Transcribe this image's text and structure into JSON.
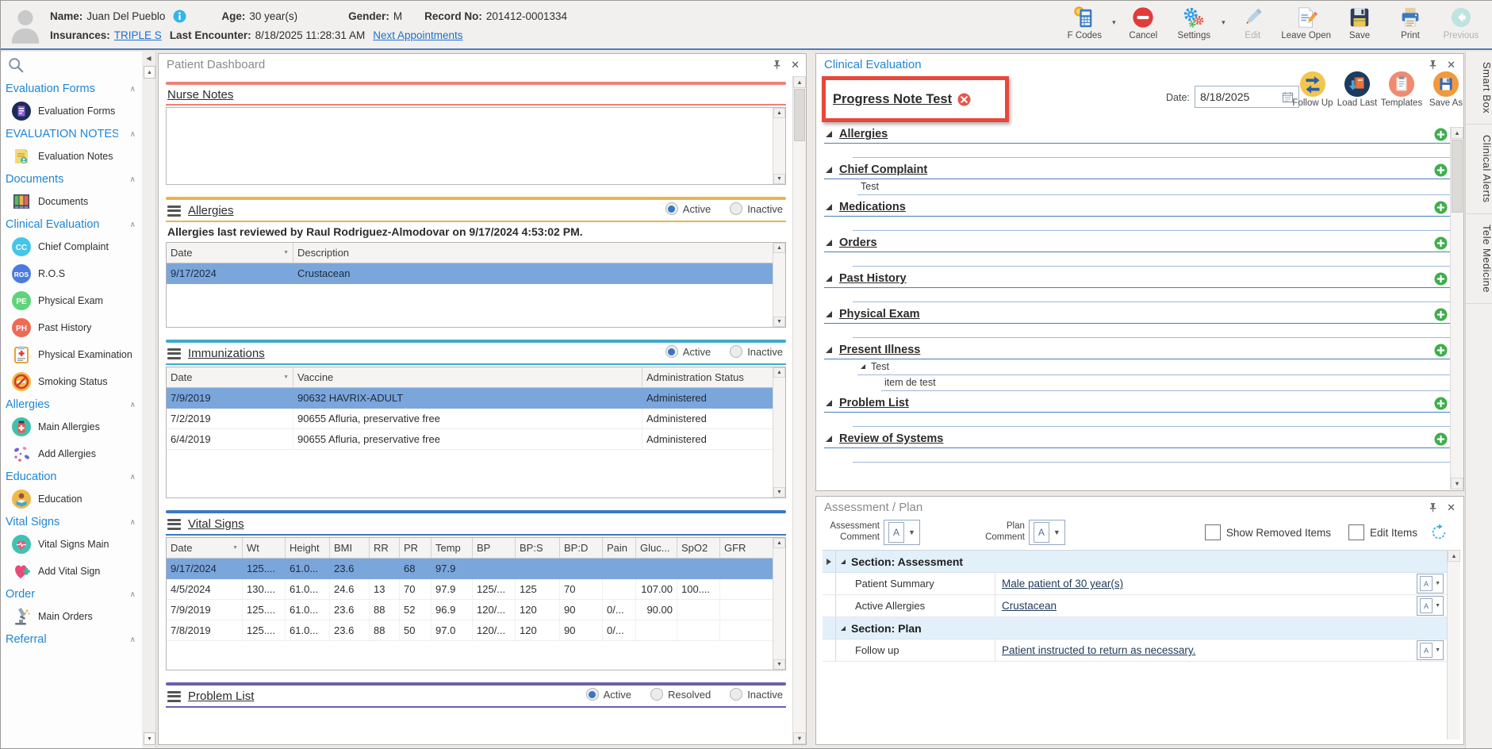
{
  "header": {
    "fields": {
      "name_label": "Name:",
      "name_value": "Juan Del Pueblo",
      "age_label": "Age:",
      "age_value": "30 year(s)",
      "gender_label": "Gender:",
      "gender_value": "M",
      "record_label": "Record No:",
      "record_value": "201412-0001334",
      "insurances_label": "Insurances:",
      "insurances_value": "TRIPLE S",
      "last_encounter_label": "Last Encounter:",
      "last_encounter_value": "8/18/2025 11:28:31 AM",
      "next_appointments_label": "Next Appointments"
    },
    "toolbar": [
      {
        "label": "F Codes",
        "icon": "fcodes-icon",
        "dropdown": true,
        "disabled": false
      },
      {
        "label": "Cancel",
        "icon": "cancel-icon",
        "dropdown": false,
        "disabled": false
      },
      {
        "label": "Settings",
        "icon": "settings-icon",
        "dropdown": true,
        "disabled": false
      },
      {
        "label": "Edit",
        "icon": "edit-icon",
        "dropdown": false,
        "disabled": true
      },
      {
        "label": "Leave Open",
        "icon": "leave-open-icon",
        "dropdown": false,
        "disabled": false
      },
      {
        "label": "Save",
        "icon": "save-icon",
        "dropdown": false,
        "disabled": false
      },
      {
        "label": "Print",
        "icon": "print-icon",
        "dropdown": false,
        "disabled": false
      },
      {
        "label": "Previous",
        "icon": "previous-icon",
        "dropdown": false,
        "disabled": true
      }
    ]
  },
  "sidebar": {
    "sections": [
      {
        "label": "Evaluation Forms",
        "items": [
          {
            "label": "Evaluation Forms",
            "icon": "evaluation-forms-icon"
          }
        ]
      },
      {
        "label": "EVALUATION NOTES",
        "items": [
          {
            "label": "Evaluation Notes",
            "icon": "evaluation-notes-icon"
          }
        ]
      },
      {
        "label": "Documents",
        "items": [
          {
            "label": "Documents",
            "icon": "documents-icon"
          }
        ]
      },
      {
        "label": "Clinical Evaluation",
        "items": [
          {
            "label": "Chief Complaint",
            "icon": "chief-complaint-icon"
          },
          {
            "label": "R.O.S",
            "icon": "ros-icon"
          },
          {
            "label": "Physical Exam",
            "icon": "physical-exam-icon"
          },
          {
            "label": "Past History",
            "icon": "past-history-icon"
          },
          {
            "label": "Physical Examination",
            "icon": "physical-examination-icon"
          },
          {
            "label": "Smoking Status",
            "icon": "smoking-status-icon"
          }
        ]
      },
      {
        "label": "Allergies",
        "items": [
          {
            "label": "Main Allergies",
            "icon": "main-allergies-icon"
          },
          {
            "label": "Add Allergies",
            "icon": "add-allergies-icon"
          }
        ]
      },
      {
        "label": "Education",
        "items": [
          {
            "label": "Education",
            "icon": "education-icon"
          }
        ]
      },
      {
        "label": "Vital Signs",
        "items": [
          {
            "label": "Vital Signs Main",
            "icon": "vital-signs-main-icon"
          },
          {
            "label": "Add Vital Sign",
            "icon": "add-vital-sign-icon"
          }
        ]
      },
      {
        "label": "Order",
        "items": [
          {
            "label": "Main Orders",
            "icon": "main-orders-icon"
          }
        ]
      },
      {
        "label": "Referral",
        "items": []
      }
    ]
  },
  "dashboard": {
    "title": "Patient Dashboard",
    "nurse_notes": {
      "title": "Nurse Notes",
      "text": "",
      "accent": "#ef8077"
    },
    "allergies": {
      "title": "Allergies",
      "accent": "#e6b54f",
      "filters": [
        {
          "label": "Active",
          "selected": true
        },
        {
          "label": "Inactive",
          "selected": false
        }
      ],
      "review_note": "Allergies last reviewed by Raul Rodriguez-Almodovar on 9/17/2024 4:53:02 PM.",
      "columns": [
        "Date",
        "Description"
      ],
      "rows": [
        {
          "cells": [
            "9/17/2024",
            "Crustacean"
          ],
          "selected": true
        }
      ]
    },
    "immunizations": {
      "title": "Immunizations",
      "accent": "#3fa9c9",
      "filters": [
        {
          "label": "Active",
          "selected": true
        },
        {
          "label": "Inactive",
          "selected": false
        }
      ],
      "columns": [
        "Date",
        "Vaccine",
        "Administration Status"
      ],
      "rows": [
        {
          "cells": [
            "7/9/2019",
            "90632 HAVRIX-ADULT",
            "Administered"
          ],
          "selected": true
        },
        {
          "cells": [
            "7/2/2019",
            "90655 Afluria, preservative free",
            "Administered"
          ],
          "selected": false
        },
        {
          "cells": [
            "6/4/2019",
            "90655 Afluria, preservative free",
            "Administered"
          ],
          "selected": false
        }
      ]
    },
    "vital_signs": {
      "title": "Vital Signs",
      "accent": "#3d78c0",
      "columns": [
        "Date",
        "Wt",
        "Height",
        "BMI",
        "RR",
        "PR",
        "Temp",
        "BP",
        "BP:S",
        "BP:D",
        "Pain",
        "Gluc...",
        "SpO2",
        "GFR"
      ],
      "rows": [
        {
          "cells": [
            "9/17/2024",
            "125....",
            "61.0...",
            "23.6",
            "",
            "68",
            "97.9",
            "",
            "",
            "",
            "",
            "",
            "",
            ""
          ],
          "selected": true
        },
        {
          "cells": [
            "4/5/2024",
            "130....",
            "61.0...",
            "24.6",
            "13",
            "70",
            "97.9",
            "125/...",
            "125",
            "70",
            "",
            "107.00",
            "100....",
            ""
          ],
          "selected": false
        },
        {
          "cells": [
            "7/9/2019",
            "125....",
            "61.0...",
            "23.6",
            "88",
            "52",
            "96.9",
            "120/...",
            "120",
            "90",
            "0/...",
            "90.00",
            "",
            ""
          ],
          "selected": false
        },
        {
          "cells": [
            "7/8/2019",
            "125....",
            "61.0...",
            "23.6",
            "88",
            "50",
            "97.0",
            "120/...",
            "120",
            "90",
            "0/...",
            "",
            "",
            ""
          ],
          "selected": false
        }
      ]
    },
    "problem_list": {
      "title": "Problem List",
      "accent": "#6b61ae",
      "filters": [
        {
          "label": "Active",
          "selected": true
        },
        {
          "label": "Resolved",
          "selected": false
        },
        {
          "label": "Inactive",
          "selected": false
        }
      ]
    }
  },
  "clinical_evaluation": {
    "panel_title": "Clinical Evaluation",
    "note_title": "Progress Note Test",
    "date_label": "Date:",
    "date_value": "8/18/2025",
    "actions": [
      {
        "label": "Follow Up",
        "icon": "follow-up-icon"
      },
      {
        "label": "Load Last",
        "icon": "load-last-icon"
      },
      {
        "label": "Templates",
        "icon": "templates-icon"
      },
      {
        "label": "Save As",
        "icon": "save-as-icon"
      }
    ],
    "sections": [
      {
        "label": "Allergies",
        "items": []
      },
      {
        "label": "Chief Complaint",
        "items": [
          {
            "text": "Test",
            "level": 1,
            "expander": false
          }
        ]
      },
      {
        "label": "Medications",
        "items": []
      },
      {
        "label": "Orders",
        "items": []
      },
      {
        "label": "Past History",
        "items": []
      },
      {
        "label": "Physical Exam",
        "items": []
      },
      {
        "label": "Present Illness",
        "items": [
          {
            "text": "Test",
            "level": 1,
            "expander": true
          },
          {
            "text": "item de test",
            "level": 2,
            "expander": false
          }
        ]
      },
      {
        "label": "Problem List",
        "items": []
      },
      {
        "label": "Review of Systems",
        "items": []
      }
    ]
  },
  "assessment_plan": {
    "title": "Assessment / Plan",
    "assessment_comment_label": "Assessment Comment",
    "plan_comment_label": "Plan Comment",
    "show_removed_label": "Show Removed Items",
    "edit_items_label": "Edit Items",
    "groups": [
      {
        "header": "Section: Assessment",
        "rows": [
          {
            "label": "Patient Summary",
            "value": "Male patient of 30 year(s)"
          },
          {
            "label": "Active Allergies",
            "value": "Crustacean"
          }
        ]
      },
      {
        "header": "Section: Plan",
        "rows": [
          {
            "label": "Follow up",
            "value": "Patient instructed to return as necessary."
          }
        ]
      }
    ]
  },
  "right_tabs": [
    {
      "label": "Smart Box"
    },
    {
      "label": "Clinical Alerts"
    },
    {
      "label": "Tele Medicine"
    }
  ],
  "colors": {
    "accent_nurse_notes": "#ef8077",
    "accent_allergies": "#e6b54f",
    "accent_immunizations": "#3fa9c9",
    "accent_vital_signs": "#3d78c0",
    "accent_problem_list": "#6b61ae",
    "selected_row": "#7ba6dc",
    "link_blue": "#1b6fd0",
    "title_blue": "#1f86d6",
    "highlight_red_box": "#e8483b",
    "green_plus": "#3daf4a"
  }
}
